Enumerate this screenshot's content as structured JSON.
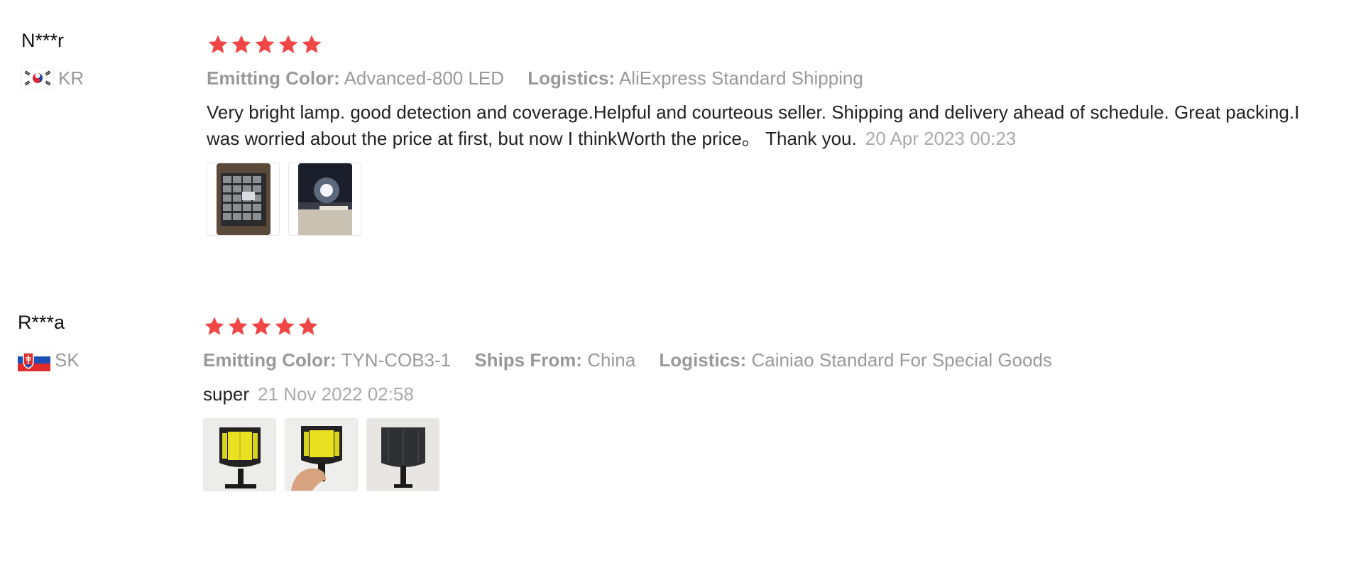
{
  "reviews": [
    {
      "reviewer_name": "N***r",
      "country_code": "KR",
      "flag_icon": "south-korea-flag-icon",
      "rating": 5,
      "attributes": [
        {
          "key": "Emitting Color:",
          "value": "Advanced-800 LED"
        },
        {
          "key": "Logistics:",
          "value": "AliExpress Standard Shipping"
        }
      ],
      "text": "Very bright lamp. good detection and coverage.Helpful and courteous seller. Shipping and delivery ahead of schedule. Great packing.I was worried about the price at first, but now I thinkWorth the price。 Thank you.",
      "date": "20 Apr 2023 00:23",
      "images": [
        "solar-panel-photo",
        "lamp-lit-at-night-photo"
      ]
    },
    {
      "reviewer_name": "R***a",
      "country_code": "SK",
      "flag_icon": "slovakia-flag-icon",
      "rating": 5,
      "attributes": [
        {
          "key": "Emitting Color:",
          "value": "TYN-COB3-1"
        },
        {
          "key": "Ships From:",
          "value": "China"
        },
        {
          "key": "Logistics:",
          "value": "Cainiao Standard For Special Goods"
        }
      ],
      "text": "super",
      "date": "21 Nov 2022 02:58",
      "images": [
        "lamp-front-photo",
        "lamp-in-hand-photo",
        "lamp-back-photo"
      ]
    }
  ],
  "colors": {
    "star": "#f04646",
    "meta_text": "#999999",
    "date_text": "#aaaaaa",
    "body_text": "#222222"
  }
}
